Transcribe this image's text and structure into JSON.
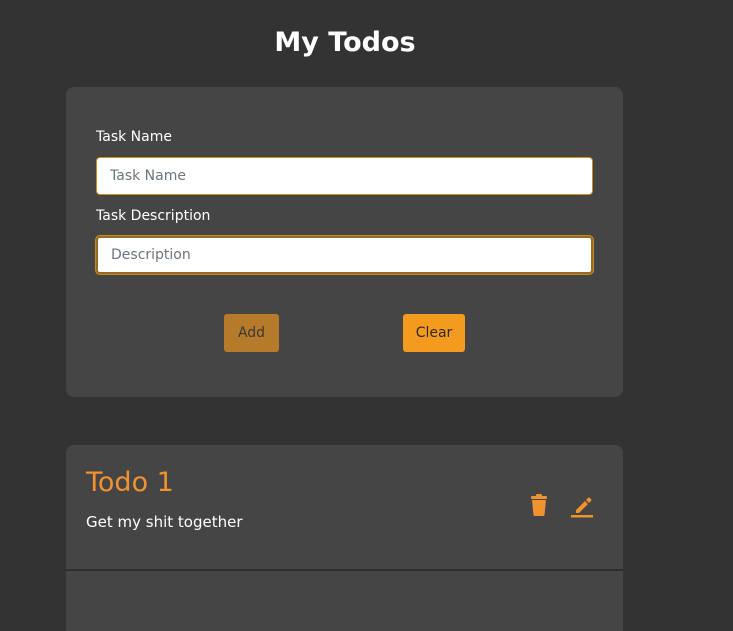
{
  "page": {
    "title": "My Todos"
  },
  "form": {
    "name_label": "Task Name",
    "name_placeholder": "Task Name",
    "name_value": "",
    "desc_label": "Task Description",
    "desc_placeholder": "Description",
    "desc_value": "",
    "add_label": "Add",
    "clear_label": "Clear"
  },
  "todos": [
    {
      "title": "Todo 1",
      "description": "Get my shit together"
    }
  ],
  "icons": {
    "delete": "trash-icon",
    "edit": "pencil-icon"
  },
  "colors": {
    "accent": "#f0922e",
    "background": "#333333",
    "card": "#454545"
  }
}
